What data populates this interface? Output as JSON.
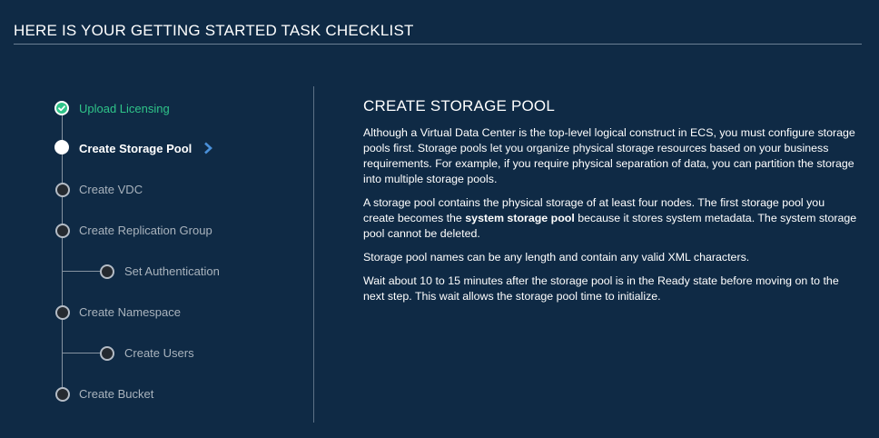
{
  "header": {
    "title": "HERE IS YOUR GETTING STARTED TASK CHECKLIST"
  },
  "steps": [
    {
      "label": "Upload Licensing",
      "state": "done",
      "icon": "checkmark-icon"
    },
    {
      "label": "Create Storage Pool",
      "state": "active",
      "icon": "chevron-right-icon"
    },
    {
      "label": "Create VDC",
      "state": "pending"
    },
    {
      "label": "Create Replication Group",
      "state": "pending"
    },
    {
      "label": "Set Authentication",
      "state": "pending"
    },
    {
      "label": "Create Namespace",
      "state": "pending"
    },
    {
      "label": "Create Users",
      "state": "pending"
    },
    {
      "label": "Create Bucket",
      "state": "pending"
    }
  ],
  "content": {
    "title": "CREATE STORAGE POOL",
    "p1": "Although a Virtual Data Center is the top-level logical construct in ECS, you must configure storage pools first. Storage pools let you organize physical storage resources based on your business requirements. For example, if you require physical separation of data, you can partition the storage into multiple storage pools.",
    "p2_before": "A storage pool contains the physical storage of at least four nodes. The first storage pool you create becomes the ",
    "p2_bold": "system storage pool",
    "p2_after": " because it stores system metadata. The system storage pool cannot be deleted.",
    "p3": "Storage pool names can be any length and contain any valid XML characters.",
    "p4": "Wait about 10 to 15 minutes after the storage pool is in the Ready state before moving on to the next step. This wait allows the storage pool time to initialize."
  },
  "colors": {
    "background": "#0f2a45",
    "done": "#2fc489",
    "pending_text": "#a9b3bd",
    "chevron": "#4a90d9"
  }
}
